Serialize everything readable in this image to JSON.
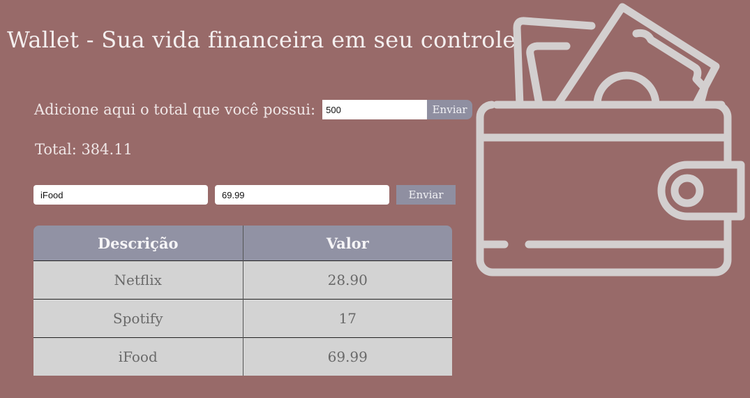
{
  "header": {
    "title": "Wallet - Sua vida financeira em seu controle."
  },
  "total_form": {
    "label": "Adicione aqui o total que você possui:",
    "value": "500",
    "button": "Enviar"
  },
  "total_display": "Total: 384.11",
  "expense_form": {
    "description_value": "iFood",
    "value_value": "69.99",
    "button": "Enviar"
  },
  "table": {
    "headers": [
      "Descrição",
      "Valor"
    ],
    "rows": [
      [
        "Netflix",
        "28.90"
      ],
      [
        "Spotify",
        "17"
      ],
      [
        "iFood",
        "69.99"
      ]
    ]
  },
  "illustration": {
    "icon": "wallet-icon",
    "color": "#d3cfcf"
  },
  "colors": {
    "background": "#986a69",
    "accent": "#9192a4",
    "table_body": "#d3d3d3"
  }
}
